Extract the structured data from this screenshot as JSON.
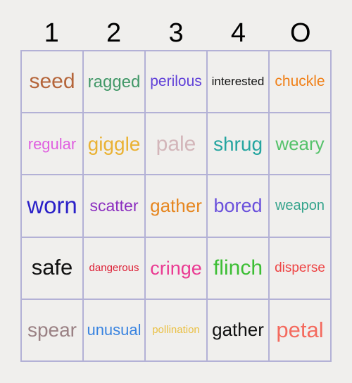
{
  "card": {
    "type": "bingo-card",
    "background_color": "#f0efed",
    "grid_line_color": "#b3b1d6",
    "columns": 5,
    "rows": 5,
    "headers": [
      {
        "label": "1",
        "color": "#000000"
      },
      {
        "label": "2",
        "color": "#000000"
      },
      {
        "label": "3",
        "color": "#000000"
      },
      {
        "label": "4",
        "color": "#000000"
      },
      {
        "label": "O",
        "color": "#000000"
      }
    ],
    "cells": [
      [
        {
          "label": "seed",
          "color": "#b5653a",
          "size": 30
        },
        {
          "label": "ragged",
          "color": "#429868",
          "size": 24
        },
        {
          "label": "perilous",
          "color": "#6040d8",
          "size": 21
        },
        {
          "label": "interested",
          "color": "#111111",
          "size": 17
        },
        {
          "label": "chuckle",
          "color": "#f08018",
          "size": 21
        }
      ],
      [
        {
          "label": "regular",
          "color": "#e060e0",
          "size": 22
        },
        {
          "label": "giggle",
          "color": "#eab234",
          "size": 28
        },
        {
          "label": "pale",
          "color": "#d3b6ba",
          "size": 30
        },
        {
          "label": "shrug",
          "color": "#25a5a0",
          "size": 28
        },
        {
          "label": "weary",
          "color": "#55c26a",
          "size": 26
        }
      ],
      [
        {
          "label": "worn",
          "color": "#2a20c8",
          "size": 33
        },
        {
          "label": "scatter",
          "color": "#8b2ec0",
          "size": 23
        },
        {
          "label": "gather",
          "color": "#e6861f",
          "size": 26
        },
        {
          "label": "bored",
          "color": "#6a50dc",
          "size": 27
        },
        {
          "label": "weapon",
          "color": "#35a48c",
          "size": 20
        }
      ],
      [
        {
          "label": "safe",
          "color": "#111111",
          "size": 31
        },
        {
          "label": "dangerous",
          "color": "#dd1f35",
          "size": 15
        },
        {
          "label": "cringe",
          "color": "#ea3a92",
          "size": 27
        },
        {
          "label": "flinch",
          "color": "#3cbe34",
          "size": 30
        },
        {
          "label": "disperse",
          "color": "#ee4444",
          "size": 19
        }
      ],
      [
        {
          "label": "spear",
          "color": "#9a8184",
          "size": 28
        },
        {
          "label": "unusual",
          "color": "#3a84e0",
          "size": 22
        },
        {
          "label": "pollination",
          "color": "#eac044",
          "size": 15
        },
        {
          "label": "gather",
          "color": "#111111",
          "size": 26
        },
        {
          "label": "petal",
          "color": "#f46a5e",
          "size": 31
        }
      ]
    ]
  }
}
